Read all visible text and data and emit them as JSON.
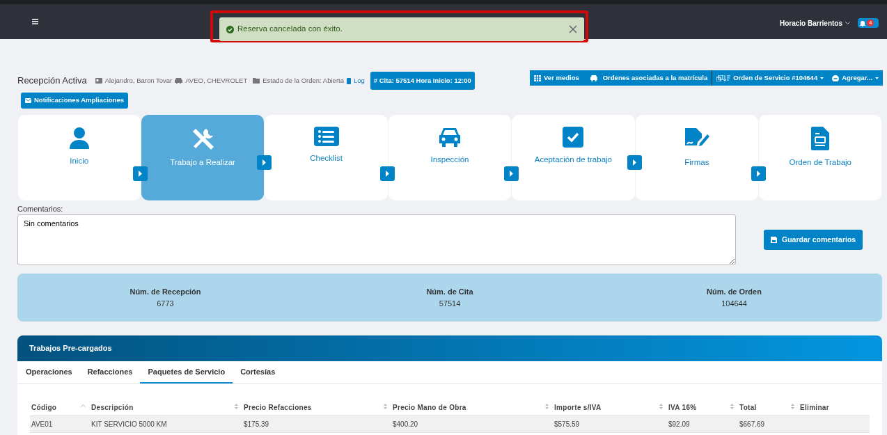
{
  "navbar": {
    "user": "Horacio Barrientos",
    "notification_count": "4"
  },
  "toast": {
    "message": "Reserva cancelada con éxito.",
    "highlighted": true
  },
  "header": {
    "title": "Recepción Activa",
    "client": "Alejandro, Baron Tovar",
    "vehicle": "AVEO, CHEVROLET",
    "order_status": "Estado de la Orden: Abierta",
    "log_link": "Log",
    "appointment_badge": "# Cita: 57514 Hora Inicio: 12:00",
    "notifications_button": "Notificaciones Ampliaciones"
  },
  "toolbar": [
    {
      "label": "Ver medios",
      "kind": "grid",
      "dropdown": false
    },
    {
      "label": "Ordenes asociadas a la matrícula",
      "kind": "car",
      "dropdown": false
    },
    {
      "label": "Orden de Servicio #104644",
      "kind": "order",
      "dropdown": true
    },
    {
      "label": "Agregar...",
      "kind": "add",
      "dropdown": true
    }
  ],
  "steps": [
    {
      "label": "Inicio",
      "kind": "user",
      "selected": false
    },
    {
      "label": "Trabajo a Realizar",
      "kind": "tools",
      "selected": true
    },
    {
      "label": "Checklist",
      "kind": "list",
      "selected": false
    },
    {
      "label": "Inspección",
      "kind": "car",
      "selected": false
    },
    {
      "label": "Aceptación de trabajo",
      "kind": "check",
      "selected": false
    },
    {
      "label": "Firmas",
      "kind": "signature",
      "selected": false
    },
    {
      "label": "Orden de Trabajo",
      "kind": "document",
      "selected": false
    }
  ],
  "comments": {
    "label": "Comentarios:",
    "value": "Sin comentarios",
    "save_button": "Guardar comentarios"
  },
  "summary": [
    {
      "label": "Núm. de Recepción",
      "value": "6773"
    },
    {
      "label": "Núm. de Cita",
      "value": "57514"
    },
    {
      "label": "Núm. de Orden",
      "value": "104644"
    }
  ],
  "panel": {
    "title": "Trabajos Pre-cargados",
    "tabs": [
      {
        "label": "Operaciones",
        "selected": false
      },
      {
        "label": "Refacciones",
        "selected": false
      },
      {
        "label": "Paquetes de Servicio",
        "selected": true
      },
      {
        "label": "Cortesías",
        "selected": false
      }
    ],
    "table": {
      "columns": [
        {
          "label": "Código",
          "sorted": true
        },
        {
          "label": "Descripción",
          "sorted": false
        },
        {
          "label": "Precio Refacciones",
          "sorted": false
        },
        {
          "label": "Precio Mano de Obra",
          "sorted": false
        },
        {
          "label": "Importe s/IVA",
          "sorted": false
        },
        {
          "label": "IVA 16%",
          "sorted": false
        },
        {
          "label": "Total",
          "sorted": false
        },
        {
          "label": "Eliminar"
        }
      ],
      "rows": [
        [
          "AVE01",
          "KIT SERVICIO 5000 KM",
          "$175.39",
          "$400.20",
          "$575.59",
          "$92.09",
          "$667.69"
        ]
      ]
    }
  }
}
